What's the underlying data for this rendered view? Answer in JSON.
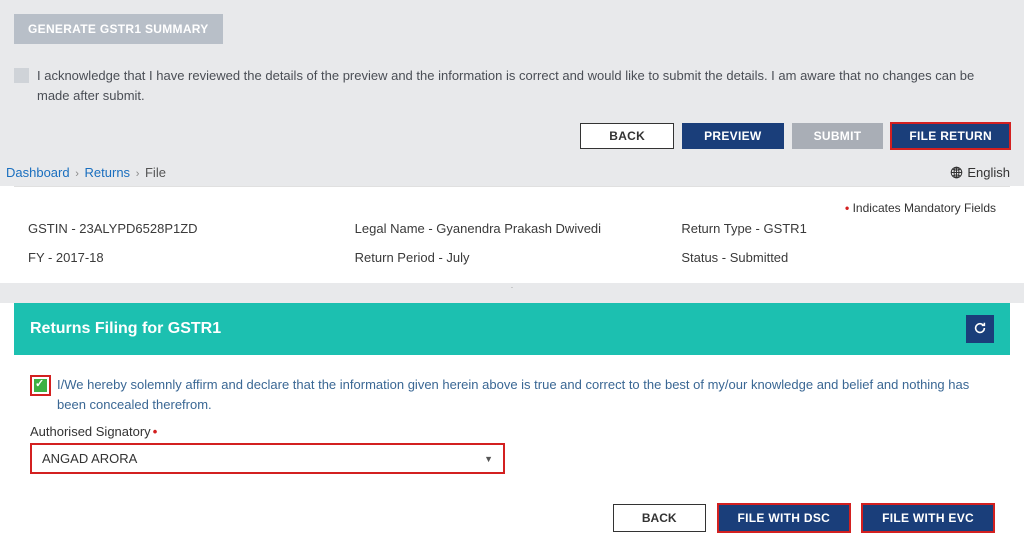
{
  "top": {
    "generate_label": "GENERATE GSTR1 SUMMARY",
    "acknowledge_text": "I acknowledge that I have reviewed the details of the preview and the information is correct and would like to submit the details. I am aware that no changes can be made after submit.",
    "back_label": "BACK",
    "preview_label": "PREVIEW",
    "submit_label": "SUBMIT",
    "file_return_label": "FILE RETURN"
  },
  "breadcrumb": {
    "dashboard": "Dashboard",
    "returns": "Returns",
    "file": "File",
    "language_label": "English"
  },
  "mandatory_note": "Indicates Mandatory Fields",
  "info": {
    "gstin_label": "GSTIN - 23ALYPD6528P1ZD",
    "legal_name_label": "Legal Name - Gyanendra Prakash Dwivedi",
    "return_type_label": "Return Type - GSTR1",
    "fy_label": "FY - 2017-18",
    "return_period_label": "Return Period - July",
    "status_label": "Status - Submitted"
  },
  "filing": {
    "header_title": "Returns Filing for GSTR1",
    "affirm_text": "I/We hereby solemnly affirm and declare that the information given herein above is true and correct to the best of my/our knowledge and belief and nothing has been concealed therefrom.",
    "signatory_label": "Authorised Signatory",
    "signatory_value": "ANGAD ARORA",
    "back_label": "BACK",
    "file_dsc_label": "FILE WITH DSC",
    "file_evc_label": "FILE WITH EVC"
  }
}
